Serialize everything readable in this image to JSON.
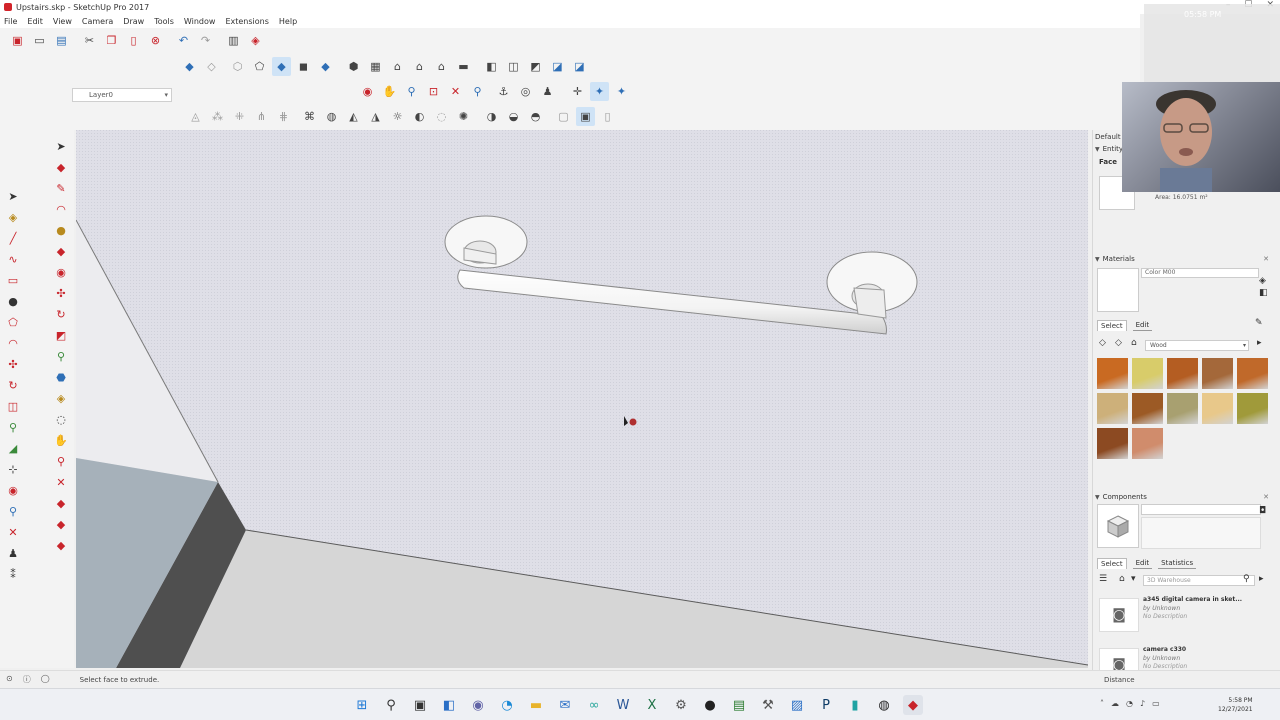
{
  "window": {
    "title": "Upstairs.skp - SketchUp Pro 2017",
    "controls": [
      "–",
      "☐",
      "✕"
    ]
  },
  "menu": [
    "File",
    "Edit",
    "View",
    "Camera",
    "Draw",
    "Tools",
    "Window",
    "Extensions",
    "Help"
  ],
  "toolbar": {
    "layer_value": "Layer0"
  },
  "tray": {
    "default_tray_label": "Default",
    "entity_info_label": "Entity Info",
    "entity_type": "Face",
    "area_text": "Area: 16.0751 m²",
    "materials_label": "Materials",
    "material_name": "Color M00",
    "materials_tabs": [
      "Select",
      "Edit"
    ],
    "material_library": "Wood",
    "swatch_colors": [
      "#c96a22",
      "#d8cc6a",
      "#b45d22",
      "#a4683a",
      "#c0692a",
      "#cdb07a",
      "#9c5a25",
      "#a8a070",
      "#e8c88a",
      "#a09a3a",
      "#8c4a22",
      "#d08c6c"
    ],
    "components_label": "Components",
    "components_tabs": [
      "Select",
      "Edit",
      "Statistics"
    ],
    "search_placeholder": "3D Warehouse",
    "results": [
      {
        "name": "a345 digital camera in sket...",
        "by": "by Unknown",
        "desc": "No Description"
      },
      {
        "name": "camera c330",
        "by": "by Unknown",
        "desc": "No Description"
      }
    ]
  },
  "statusbar": {
    "text": "Select face to extrude.",
    "distance_label": "Distance"
  },
  "webcam_overlay": {
    "time": "05:58 PM"
  },
  "taskbar": {
    "time": "5:58 PM",
    "date": "12/27/2021"
  }
}
